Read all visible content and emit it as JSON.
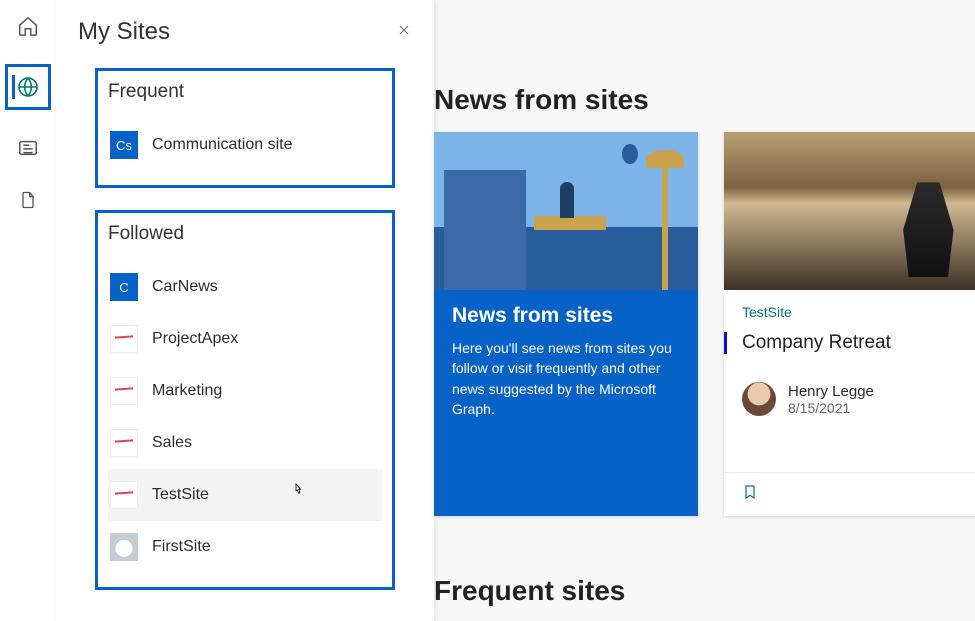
{
  "rail": {
    "icons": [
      "home-icon",
      "globe-icon",
      "news-icon",
      "file-icon"
    ]
  },
  "panel": {
    "title": "My Sites",
    "close_aria": "Close",
    "frequent_label": "Frequent",
    "followed_label": "Followed",
    "frequent_sites": [
      {
        "initials": "Cs",
        "name": "Communication site",
        "icon_type": "cs"
      }
    ],
    "followed_sites": [
      {
        "initials": "C",
        "name": "CarNews",
        "icon_type": "c"
      },
      {
        "initials": "",
        "name": "ProjectApex",
        "icon_type": "chart"
      },
      {
        "initials": "",
        "name": "Marketing",
        "icon_type": "chart"
      },
      {
        "initials": "",
        "name": "Sales",
        "icon_type": "chart"
      },
      {
        "initials": "",
        "name": "TestSite",
        "icon_type": "chart",
        "hovered": true
      },
      {
        "initials": "",
        "name": "FirstSite",
        "icon_type": "car"
      }
    ]
  },
  "main": {
    "news_heading_fragment": "News from sites",
    "frequent_heading_fragment": "Frequent sites",
    "cards": {
      "blue": {
        "title": "News from sites",
        "text": "Here you'll see news from sites you follow or visit frequently and other news suggested by the Microsoft Graph."
      },
      "retreat": {
        "site_link": "TestSite",
        "heading": "Company Retreat",
        "author": "Henry Legge",
        "date": "8/15/2021"
      }
    }
  }
}
